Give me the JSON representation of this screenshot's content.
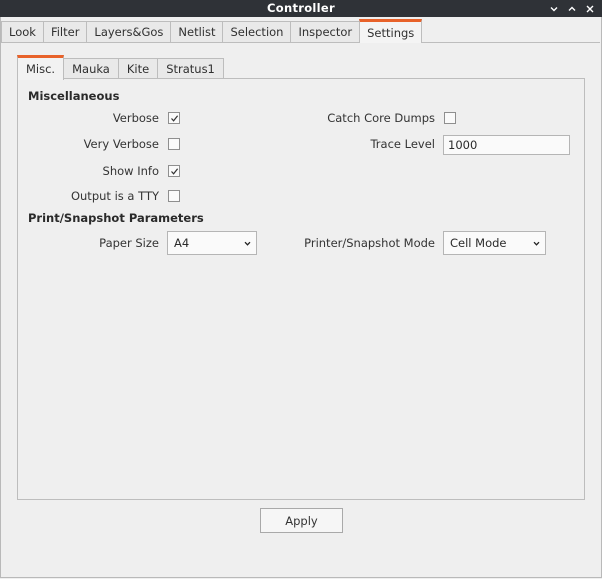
{
  "window": {
    "title": "Controller"
  },
  "top_tabs": [
    "Look",
    "Filter",
    "Layers&Gos",
    "Netlist",
    "Selection",
    "Inspector",
    "Settings"
  ],
  "active_top_tab": "Settings",
  "inner_tabs": [
    "Misc.",
    "Mauka",
    "Kite",
    "Stratus1"
  ],
  "active_inner_tab": "Misc.",
  "misc": {
    "section_title": "Miscellaneous",
    "verbose_label": "Verbose",
    "verbose_checked": true,
    "very_verbose_label": "Very Verbose",
    "very_verbose_checked": false,
    "show_info_label": "Show Info",
    "show_info_checked": true,
    "output_tty_label": "Output is a TTY",
    "output_tty_checked": false,
    "catch_core_label": "Catch Core Dumps",
    "catch_core_checked": false,
    "trace_level_label": "Trace Level",
    "trace_level_value": "1000"
  },
  "print": {
    "section_title": "Print/Snapshot Parameters",
    "paper_size_label": "Paper Size",
    "paper_size_value": "A4",
    "printer_mode_label": "Printer/Snapshot Mode",
    "printer_mode_value": "Cell Mode"
  },
  "apply_label": "Apply",
  "accent_color": "#e8622a"
}
